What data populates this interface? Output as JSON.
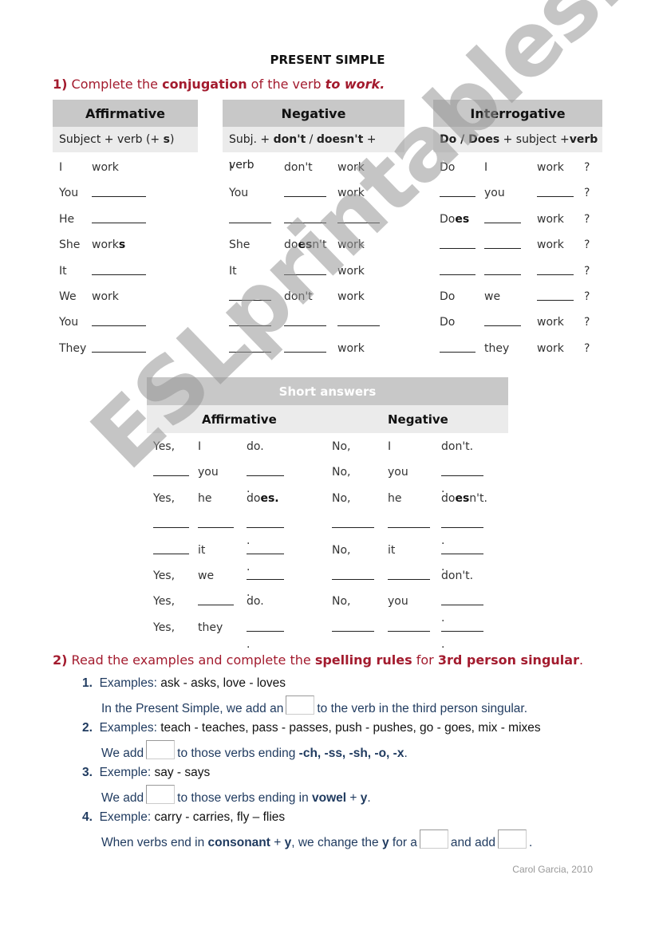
{
  "title": "PRESENT SIMPLE",
  "exercise1": {
    "number": "1)",
    "instruction_pre": " Complete the ",
    "instruction_bold": "conjugation",
    "instruction_mid": " of the verb ",
    "instruction_verb": "to work.",
    "affirmative": {
      "header": "Affirmative",
      "formula_pre": "Subject + verb (+ ",
      "formula_bold": "s",
      "formula_post": ")",
      "rows": [
        {
          "subject": "I",
          "verb": "work"
        },
        {
          "subject": "You",
          "verb": ""
        },
        {
          "subject": "He",
          "verb": ""
        },
        {
          "subject": "She",
          "verb": "work",
          "verb_bold_suffix": "s"
        },
        {
          "subject": "It",
          "verb": ""
        },
        {
          "subject": "We",
          "verb": "work"
        },
        {
          "subject": "You",
          "verb": ""
        },
        {
          "subject": "They",
          "verb": ""
        }
      ]
    },
    "negative": {
      "header": "Negative",
      "formula_pre": "Subj. + ",
      "formula_bold1": "don't",
      "formula_sep": " / ",
      "formula_bold2": "doesn't",
      "formula_post": " + verb",
      "rows": [
        {
          "subject": "I",
          "aux": "don't",
          "verb": "work"
        },
        {
          "subject": "You",
          "aux": "",
          "verb": "work"
        },
        {
          "subject": "",
          "aux": "",
          "verb": ""
        },
        {
          "subject": "She",
          "aux_pre": "do",
          "aux_bold": "es",
          "aux_post": "n't",
          "verb": "work"
        },
        {
          "subject": "It",
          "aux": "",
          "verb": "work"
        },
        {
          "subject": "",
          "aux": "don't",
          "verb": "work"
        },
        {
          "subject": "",
          "aux": "",
          "verb": ""
        },
        {
          "subject": "",
          "aux": "",
          "verb": "work"
        }
      ]
    },
    "interrogative": {
      "header": "Interrogative",
      "formula_bold1": "Do / Does",
      "formula_mid": " + subject +",
      "formula_bold2": "verb",
      "qmark": "?",
      "rows": [
        {
          "aux": "Do",
          "subject": "I",
          "verb": "work"
        },
        {
          "aux": "",
          "subject": "you",
          "verb": ""
        },
        {
          "aux_pre": "Do",
          "aux_bold": "es",
          "subject": "",
          "verb": "work"
        },
        {
          "aux": "",
          "subject": "",
          "verb": "work"
        },
        {
          "aux": "",
          "subject": "",
          "verb": ""
        },
        {
          "aux": "Do",
          "subject": "we",
          "verb": ""
        },
        {
          "aux": "Do",
          "subject": "",
          "verb": "work"
        },
        {
          "aux": "",
          "subject": "they",
          "verb": "work"
        }
      ]
    }
  },
  "short_answers": {
    "header": "Short answers",
    "affirmative_label": "Affirmative",
    "negative_label": "Negative",
    "rows": [
      {
        "a1": "Yes,",
        "a2": "I",
        "a3": "do.",
        "n1": "No,",
        "n2": "I",
        "n3": "don't."
      },
      {
        "a1": "",
        "a2": "you",
        "a3": "",
        "n1": "No,",
        "n2": "you",
        "n3": ""
      },
      {
        "a1": "Yes,",
        "a2": "he",
        "a3_pre": "do",
        "a3_bold": "es.",
        "n1": "No,",
        "n2": "he",
        "n3_pre": "do",
        "n3_bold": "es",
        "n3_post": "n't."
      },
      {
        "a1": "",
        "a2": "",
        "a3": "",
        "n1": "",
        "n2": "",
        "n3": ""
      },
      {
        "a1": "",
        "a2": "it",
        "a3": "",
        "n1": "No,",
        "n2": "it",
        "n3": ""
      },
      {
        "a1": "Yes,",
        "a2": "we",
        "a3": "",
        "n1": "",
        "n2": "",
        "n3": "don't."
      },
      {
        "a1": "Yes,",
        "a2": "",
        "a3": "do.",
        "n1": "No,",
        "n2": "you",
        "n3": ""
      },
      {
        "a1": "Yes,",
        "a2": "they",
        "a3": "",
        "n1": "",
        "n2": "",
        "n3": ""
      }
    ]
  },
  "exercise2": {
    "number": "2)",
    "instruction_pre": " Read the examples and complete the ",
    "instruction_bold1": "spelling rules",
    "instruction_mid": " for ",
    "instruction_bold2": "3rd person singular",
    "instruction_post": ".",
    "rules": [
      {
        "num": "1.",
        "label": "Examples:",
        "examples": " ask - asks, love - loves",
        "line2_pre": "In the Present Simple, we add an",
        "line2_post": "to the verb in the third person singular."
      },
      {
        "num": "2.",
        "label": "Examples:",
        "examples": " teach - teaches, pass - passes, push - pushes, go - goes, mix - mixes",
        "line2_pre": "We add",
        "line2_post": "to those verbs ending ",
        "line2_bold": "-ch, -ss, -sh, -o, -x",
        "line2_end": "."
      },
      {
        "num": "3.",
        "label": "Exemple:",
        "examples": " say - says",
        "line2_pre": "We add",
        "line2_post": "to those verbs ending in ",
        "line2_bold": "vowel",
        "line2_mid": " + ",
        "line2_bold2": "y",
        "line2_end": "."
      },
      {
        "num": "4.",
        "label": "Exemple:",
        "examples": " carry - carries, fly – flies",
        "line2_pre": "When verbs end in ",
        "line2_bold": "consonant",
        "line2_mid": " + ",
        "line2_bold2": "y",
        "line2_mid2": ", we change the ",
        "line2_bold3": "y",
        "line2_mid3": " for a",
        "line2_mid4": "and add",
        "line2_end": "."
      }
    ]
  },
  "credit": "Carol Garcia, 2010",
  "watermark": "ESLprintables.com",
  "colors": {
    "accent": "#a31b2e",
    "rule_text": "#1f3a5f",
    "header_bg": "#c8c8c8",
    "subheader_bg": "#ebebeb"
  }
}
